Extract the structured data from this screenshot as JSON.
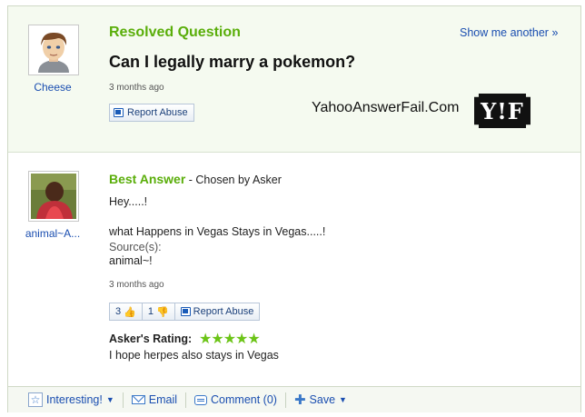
{
  "question": {
    "status_label": "Resolved Question",
    "show_another": "Show me another »",
    "asker_name": "Cheese",
    "title": "Can I legally marry a pokemon?",
    "timestamp": "3 months ago",
    "report_abuse": "Report Abuse",
    "watermark": "YahooAnswerFail.Com",
    "logo_text": "Y!F"
  },
  "answer": {
    "best_label": "Best Answer",
    "chosen_by": " - Chosen by Asker",
    "answerer_name": "animal~A...",
    "line1": "Hey.....!",
    "line2": "what Happens in Vegas Stays in Vegas.....!",
    "sources_label": "Source(s):",
    "source_value": "animal~!",
    "timestamp": "3 months ago",
    "thumbs_up": "3",
    "thumbs_down": "1",
    "report_abuse": "Report Abuse",
    "rating_label": "Asker's Rating:",
    "rating_stars": "★★★★★",
    "rating_value": 5,
    "rating_comment": "I hope herpes also stays in Vegas"
  },
  "footer": {
    "interesting": "Interesting!",
    "email": "Email",
    "comment": "Comment (0)",
    "save": "Save"
  },
  "colors": {
    "accent_green": "#5aae0a",
    "link_blue": "#1a4eb0",
    "star_green": "#6cc417"
  }
}
